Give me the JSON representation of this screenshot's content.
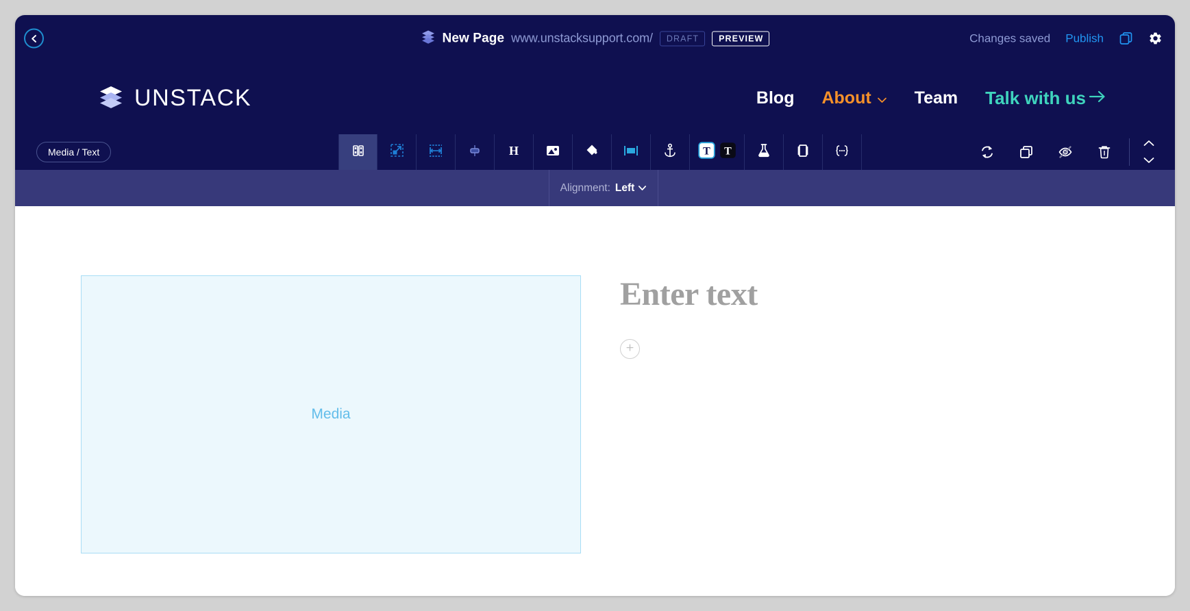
{
  "topbar": {
    "back_icon": "chevron-left-icon",
    "logo_icon": "unstack-stack-icon",
    "page_title": "New Page",
    "page_url": "www.unstacksupport.com/",
    "draft_badge": "DRAFT",
    "preview_badge": "PREVIEW",
    "changes_saved": "Changes saved",
    "publish_label": "Publish",
    "duplicate_icon": "copy-icon",
    "settings_icon": "gear-icon"
  },
  "sitenav": {
    "brand_icon": "unstack-stack-icon",
    "brand_name": "UNSTACK",
    "links": [
      {
        "label": "Blog",
        "has_caret": false,
        "color": "#ffffff"
      },
      {
        "label": "About",
        "has_caret": true,
        "color": "#f6912a"
      },
      {
        "label": "Team",
        "has_caret": false,
        "color": "#ffffff"
      }
    ],
    "cta_label": "Talk with us",
    "cta_arrow": "arrow-right-icon",
    "cta_color": "#3fd4bd"
  },
  "toolbar": {
    "block_pill_label": "Media / Text",
    "tools": [
      {
        "name": "layout-columns-icon",
        "active": true
      },
      {
        "name": "resize-icon",
        "active": false
      },
      {
        "name": "spacing-width-icon",
        "active": false
      },
      {
        "name": "vertical-align-icon",
        "active": false
      },
      {
        "name": "heading-icon",
        "active": false
      },
      {
        "name": "image-icon",
        "active": false
      },
      {
        "name": "fill-color-icon",
        "active": false
      },
      {
        "name": "background-icon",
        "active": false
      },
      {
        "name": "anchor-icon",
        "active": false
      },
      {
        "name": "text-style-icon",
        "active": true
      },
      {
        "name": "experiment-flask-icon",
        "active": false
      },
      {
        "name": "slideshow-icon",
        "active": false
      },
      {
        "name": "code-embed-icon",
        "active": false
      }
    ],
    "right_tools": [
      {
        "name": "refresh-icon"
      },
      {
        "name": "duplicate-block-icon"
      },
      {
        "name": "hide-eye-icon"
      },
      {
        "name": "delete-trash-icon"
      }
    ],
    "move_up_icon": "chevron-up-icon",
    "move_down_icon": "chevron-down-icon"
  },
  "subbar": {
    "alignment_label": "Alignment:",
    "alignment_value": "Left",
    "alignment_caret": "chevron-down-icon"
  },
  "canvas": {
    "media_placeholder": "Media",
    "text_placeholder": "Enter text",
    "add_block_icon": "plus-circle-icon"
  },
  "colors": {
    "editor_navy": "#0f1050",
    "subbar_purple": "#37397a",
    "accent_blue": "#2196f3",
    "accent_teal": "#3fd4bd",
    "accent_orange": "#f6912a",
    "media_fill": "#ecf8fd",
    "media_border": "#a8ddf5",
    "media_text": "#62bdea"
  }
}
